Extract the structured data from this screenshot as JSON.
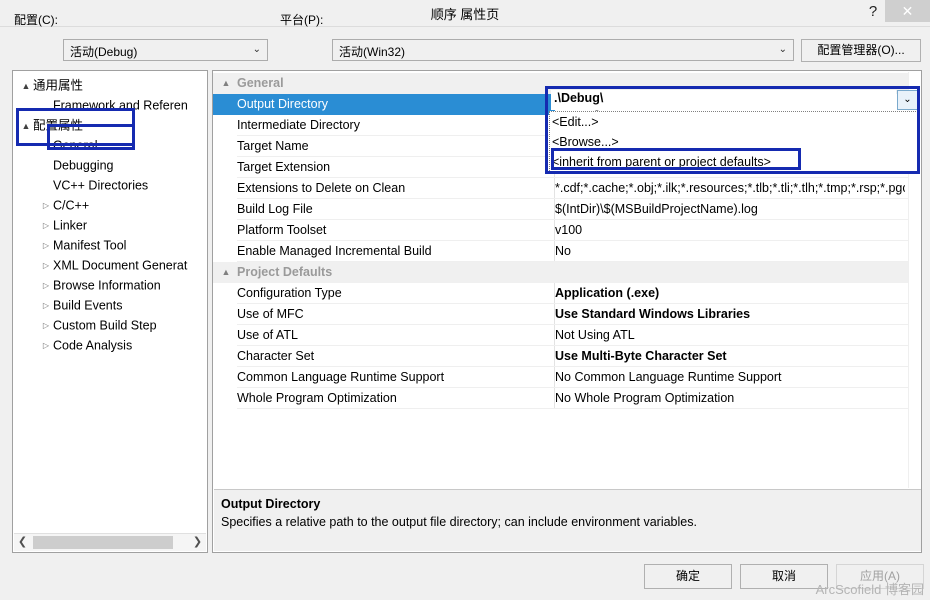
{
  "window": {
    "title": "顺序 属性页",
    "help_icon": "question-mark-icon",
    "help_label": "?",
    "close_label": "✕"
  },
  "config_bar": {
    "configuration_label": "配置(C):",
    "configuration_value": "活动(Debug)",
    "platform_label": "平台(P):",
    "platform_value": "活动(Win32)",
    "config_manager_button": "配置管理器(O)...",
    "dropdown_arrow": "⌄"
  },
  "tree": {
    "items": [
      {
        "label": "通用属性",
        "indent": 0,
        "glyph": "▲",
        "state": "expanded"
      },
      {
        "label": "Framework and Referen",
        "indent": 1,
        "glyph": "",
        "state": "leaf"
      },
      {
        "label": "配置属性",
        "indent": 0,
        "glyph": "▲",
        "state": "expanded"
      },
      {
        "label": "General",
        "indent": 1,
        "glyph": "",
        "state": "selected"
      },
      {
        "label": "Debugging",
        "indent": 1,
        "glyph": "",
        "state": "leaf"
      },
      {
        "label": "VC++ Directories",
        "indent": 1,
        "glyph": "",
        "state": "leaf"
      },
      {
        "label": "C/C++",
        "indent": 1,
        "glyph": "▷",
        "state": "collapsed"
      },
      {
        "label": "Linker",
        "indent": 1,
        "glyph": "▷",
        "state": "collapsed"
      },
      {
        "label": "Manifest Tool",
        "indent": 1,
        "glyph": "▷",
        "state": "collapsed"
      },
      {
        "label": "XML Document Generat",
        "indent": 1,
        "glyph": "▷",
        "state": "collapsed"
      },
      {
        "label": "Browse Information",
        "indent": 1,
        "glyph": "▷",
        "state": "collapsed"
      },
      {
        "label": "Build Events",
        "indent": 1,
        "glyph": "▷",
        "state": "collapsed"
      },
      {
        "label": "Custom Build Step",
        "indent": 1,
        "glyph": "▷",
        "state": "collapsed"
      },
      {
        "label": "Code Analysis",
        "indent": 1,
        "glyph": "▷",
        "state": "collapsed"
      }
    ],
    "scrollbar": {
      "left_arrow": "❮",
      "right_arrow": "❯"
    }
  },
  "grid": {
    "rows": [
      {
        "type": "category",
        "name": "General",
        "value": "",
        "glyph": "▲"
      },
      {
        "type": "property",
        "name": "Output Directory",
        "value": ".\\Debug\\",
        "bold": true,
        "selected": true
      },
      {
        "type": "property",
        "name": "Intermediate Directory",
        "value": "",
        "bold": false
      },
      {
        "type": "property",
        "name": "Target Name",
        "value": "",
        "bold": false
      },
      {
        "type": "property",
        "name": "Target Extension",
        "value": "",
        "bold": false
      },
      {
        "type": "property",
        "name": "Extensions to Delete on Clean",
        "value": "*.cdf;*.cache;*.obj;*.ilk;*.resources;*.tlb;*.tli;*.tlh;*.tmp;*.rsp;*.pgc",
        "bold": false
      },
      {
        "type": "property",
        "name": "Build Log File",
        "value": "$(IntDir)\\$(MSBuildProjectName).log",
        "bold": false
      },
      {
        "type": "property",
        "name": "Platform Toolset",
        "value": "v100",
        "bold": false
      },
      {
        "type": "property",
        "name": "Enable Managed Incremental Build",
        "value": "No",
        "bold": false
      },
      {
        "type": "category",
        "name": "Project Defaults",
        "value": "",
        "glyph": "▲"
      },
      {
        "type": "property",
        "name": "Configuration Type",
        "value": "Application (.exe)",
        "bold": true
      },
      {
        "type": "property",
        "name": "Use of MFC",
        "value": "Use Standard Windows Libraries",
        "bold": true
      },
      {
        "type": "property",
        "name": "Use of ATL",
        "value": "Not Using ATL",
        "bold": false
      },
      {
        "type": "property",
        "name": "Character Set",
        "value": "Use Multi-Byte Character Set",
        "bold": true
      },
      {
        "type": "property",
        "name": "Common Language Runtime Support",
        "value": "No Common Language Runtime Support",
        "bold": false
      },
      {
        "type": "property",
        "name": "Whole Program Optimization",
        "value": "No Whole Program Optimization",
        "bold": false
      }
    ]
  },
  "editor": {
    "value": ".\\Debug\\",
    "dropdown_arrow": "⌄",
    "options": [
      "<Edit...>",
      "<Browse...>",
      "<inherit from parent or project defaults>"
    ]
  },
  "description": {
    "title": "Output Directory",
    "text": "Specifies a relative path to the output file directory; can include environment variables."
  },
  "footer": {
    "ok_label": "确定",
    "cancel_label": "取消",
    "apply_label": "应用(A)"
  },
  "watermark": "ArcScofield 博客园",
  "colors": {
    "selection_blue": "#2a8dd4",
    "annotation_blue": "#152ab0",
    "window_bg": "#f0f0f0"
  }
}
